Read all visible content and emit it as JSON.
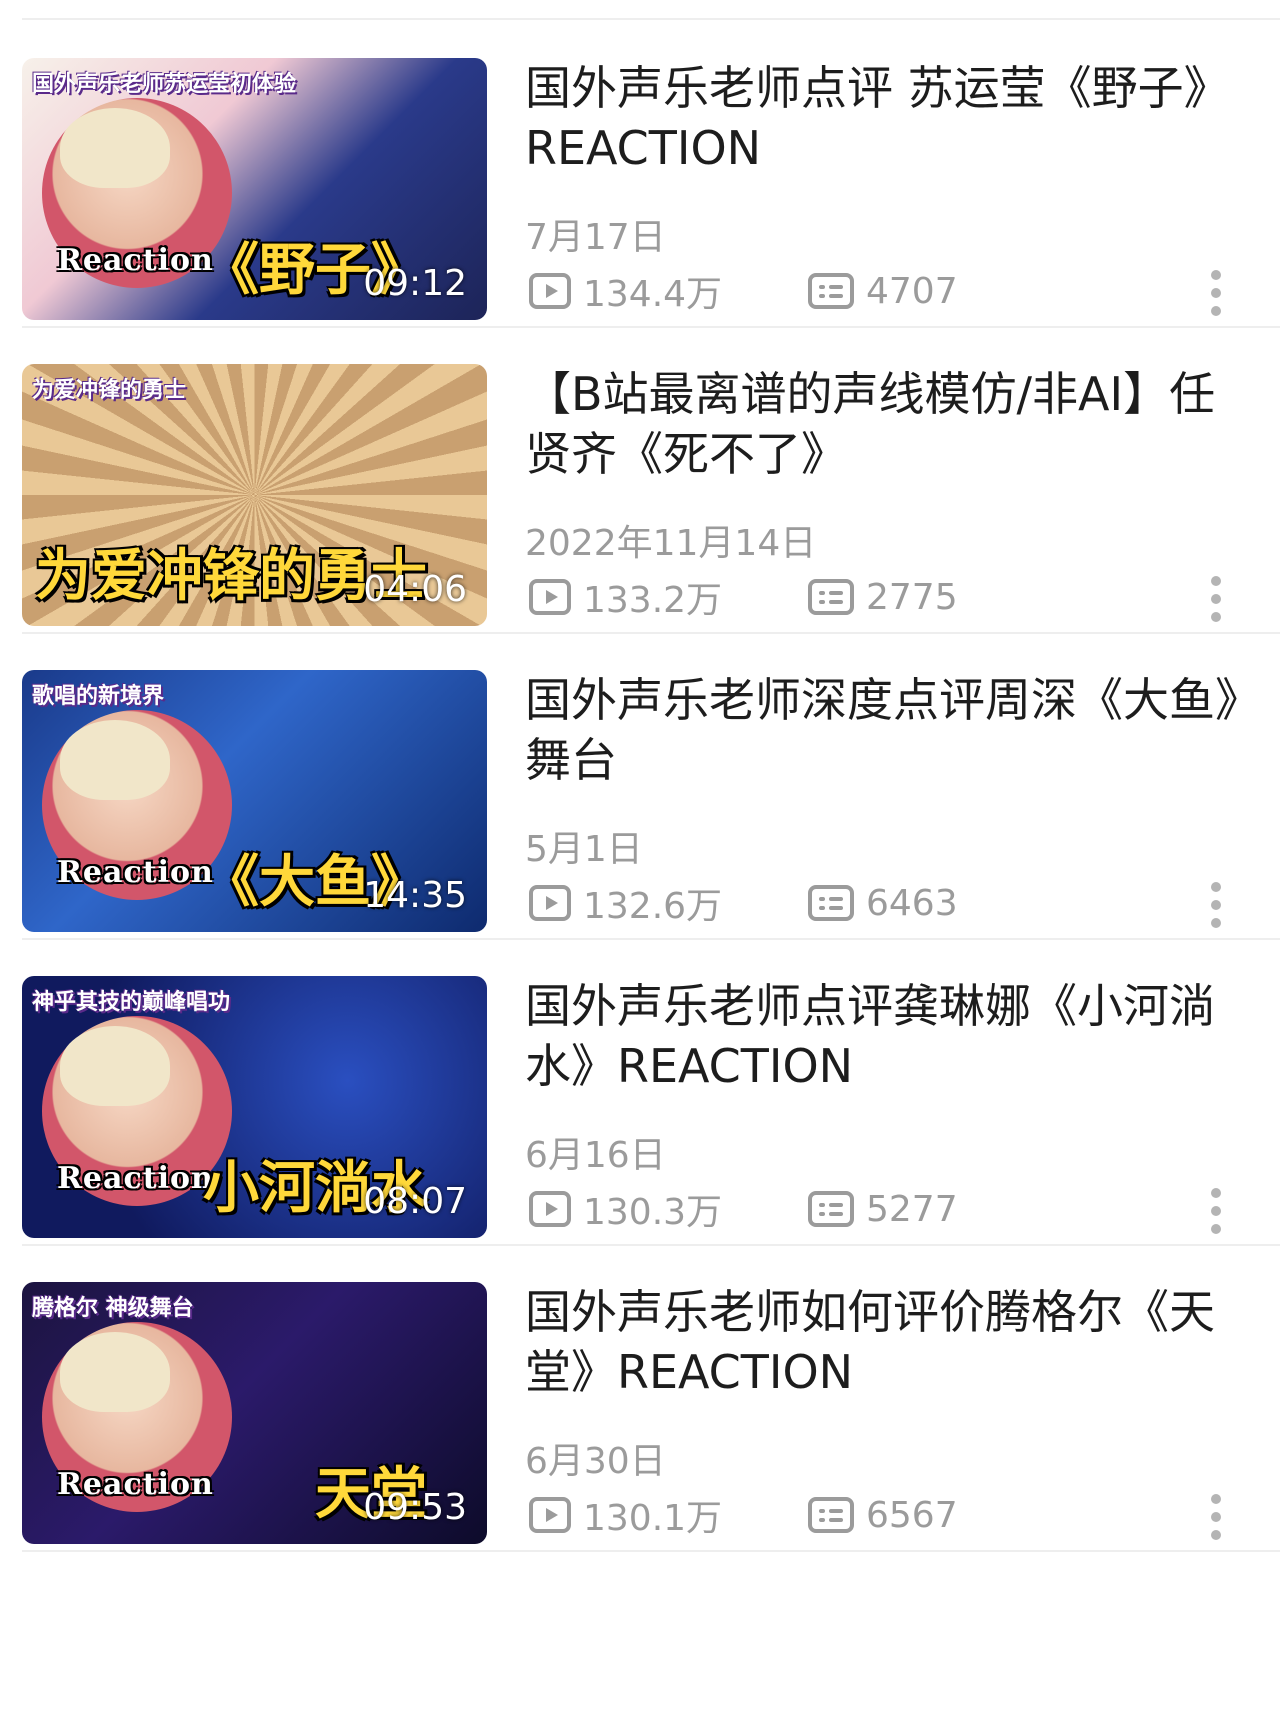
{
  "videos": [
    {
      "thumb_tag": "国外声乐老师苏运莹初体验",
      "thumb_song": "《野子》",
      "thumb_reaction": "Reaction",
      "duration": "09:12",
      "title": "国外声乐老师点评 苏运莹《野子》REACTION",
      "date": "7月17日",
      "views": "134.4万",
      "danmaku": "4707"
    },
    {
      "thumb_tag": "为爱冲锋的勇士",
      "thumb_song": "为爱冲锋的勇士",
      "thumb_reaction": "",
      "duration": "04:06",
      "title": "【B站最离谱的声线模仿/非AI】任贤齐《死不了》",
      "date": "2022年11月14日",
      "views": "133.2万",
      "danmaku": "2775"
    },
    {
      "thumb_tag": "歌唱的新境界",
      "thumb_song": "《大鱼》",
      "thumb_reaction": "Reaction",
      "duration": "14:35",
      "title": "国外声乐老师深度点评周深《大鱼》舞台",
      "date": "5月1日",
      "views": "132.6万",
      "danmaku": "6463"
    },
    {
      "thumb_tag": "神乎其技的巅峰唱功",
      "thumb_song": "小河淌水",
      "thumb_reaction": "Reaction",
      "duration": "08:07",
      "title": "国外声乐老师点评龚琳娜《小河淌水》REACTION",
      "date": "6月16日",
      "views": "130.3万",
      "danmaku": "5277"
    },
    {
      "thumb_tag": "腾格尔 神级舞台",
      "thumb_song": "天堂",
      "thumb_reaction": "Reaction",
      "duration": "09:53",
      "title": "国外声乐老师如何评价腾格尔《天堂》REACTION",
      "date": "6月30日",
      "views": "130.1万",
      "danmaku": "6567"
    }
  ],
  "icons": {
    "views": "play-count-icon",
    "danmaku": "danmaku-count-icon",
    "more": "more-vertical-icon"
  },
  "colors": {
    "title": "#1d1d1d",
    "meta": "#9b9b9b",
    "separator": "#eeeeee",
    "accent_pink": "#e8457a",
    "song_yellow": "#ffd83a"
  }
}
